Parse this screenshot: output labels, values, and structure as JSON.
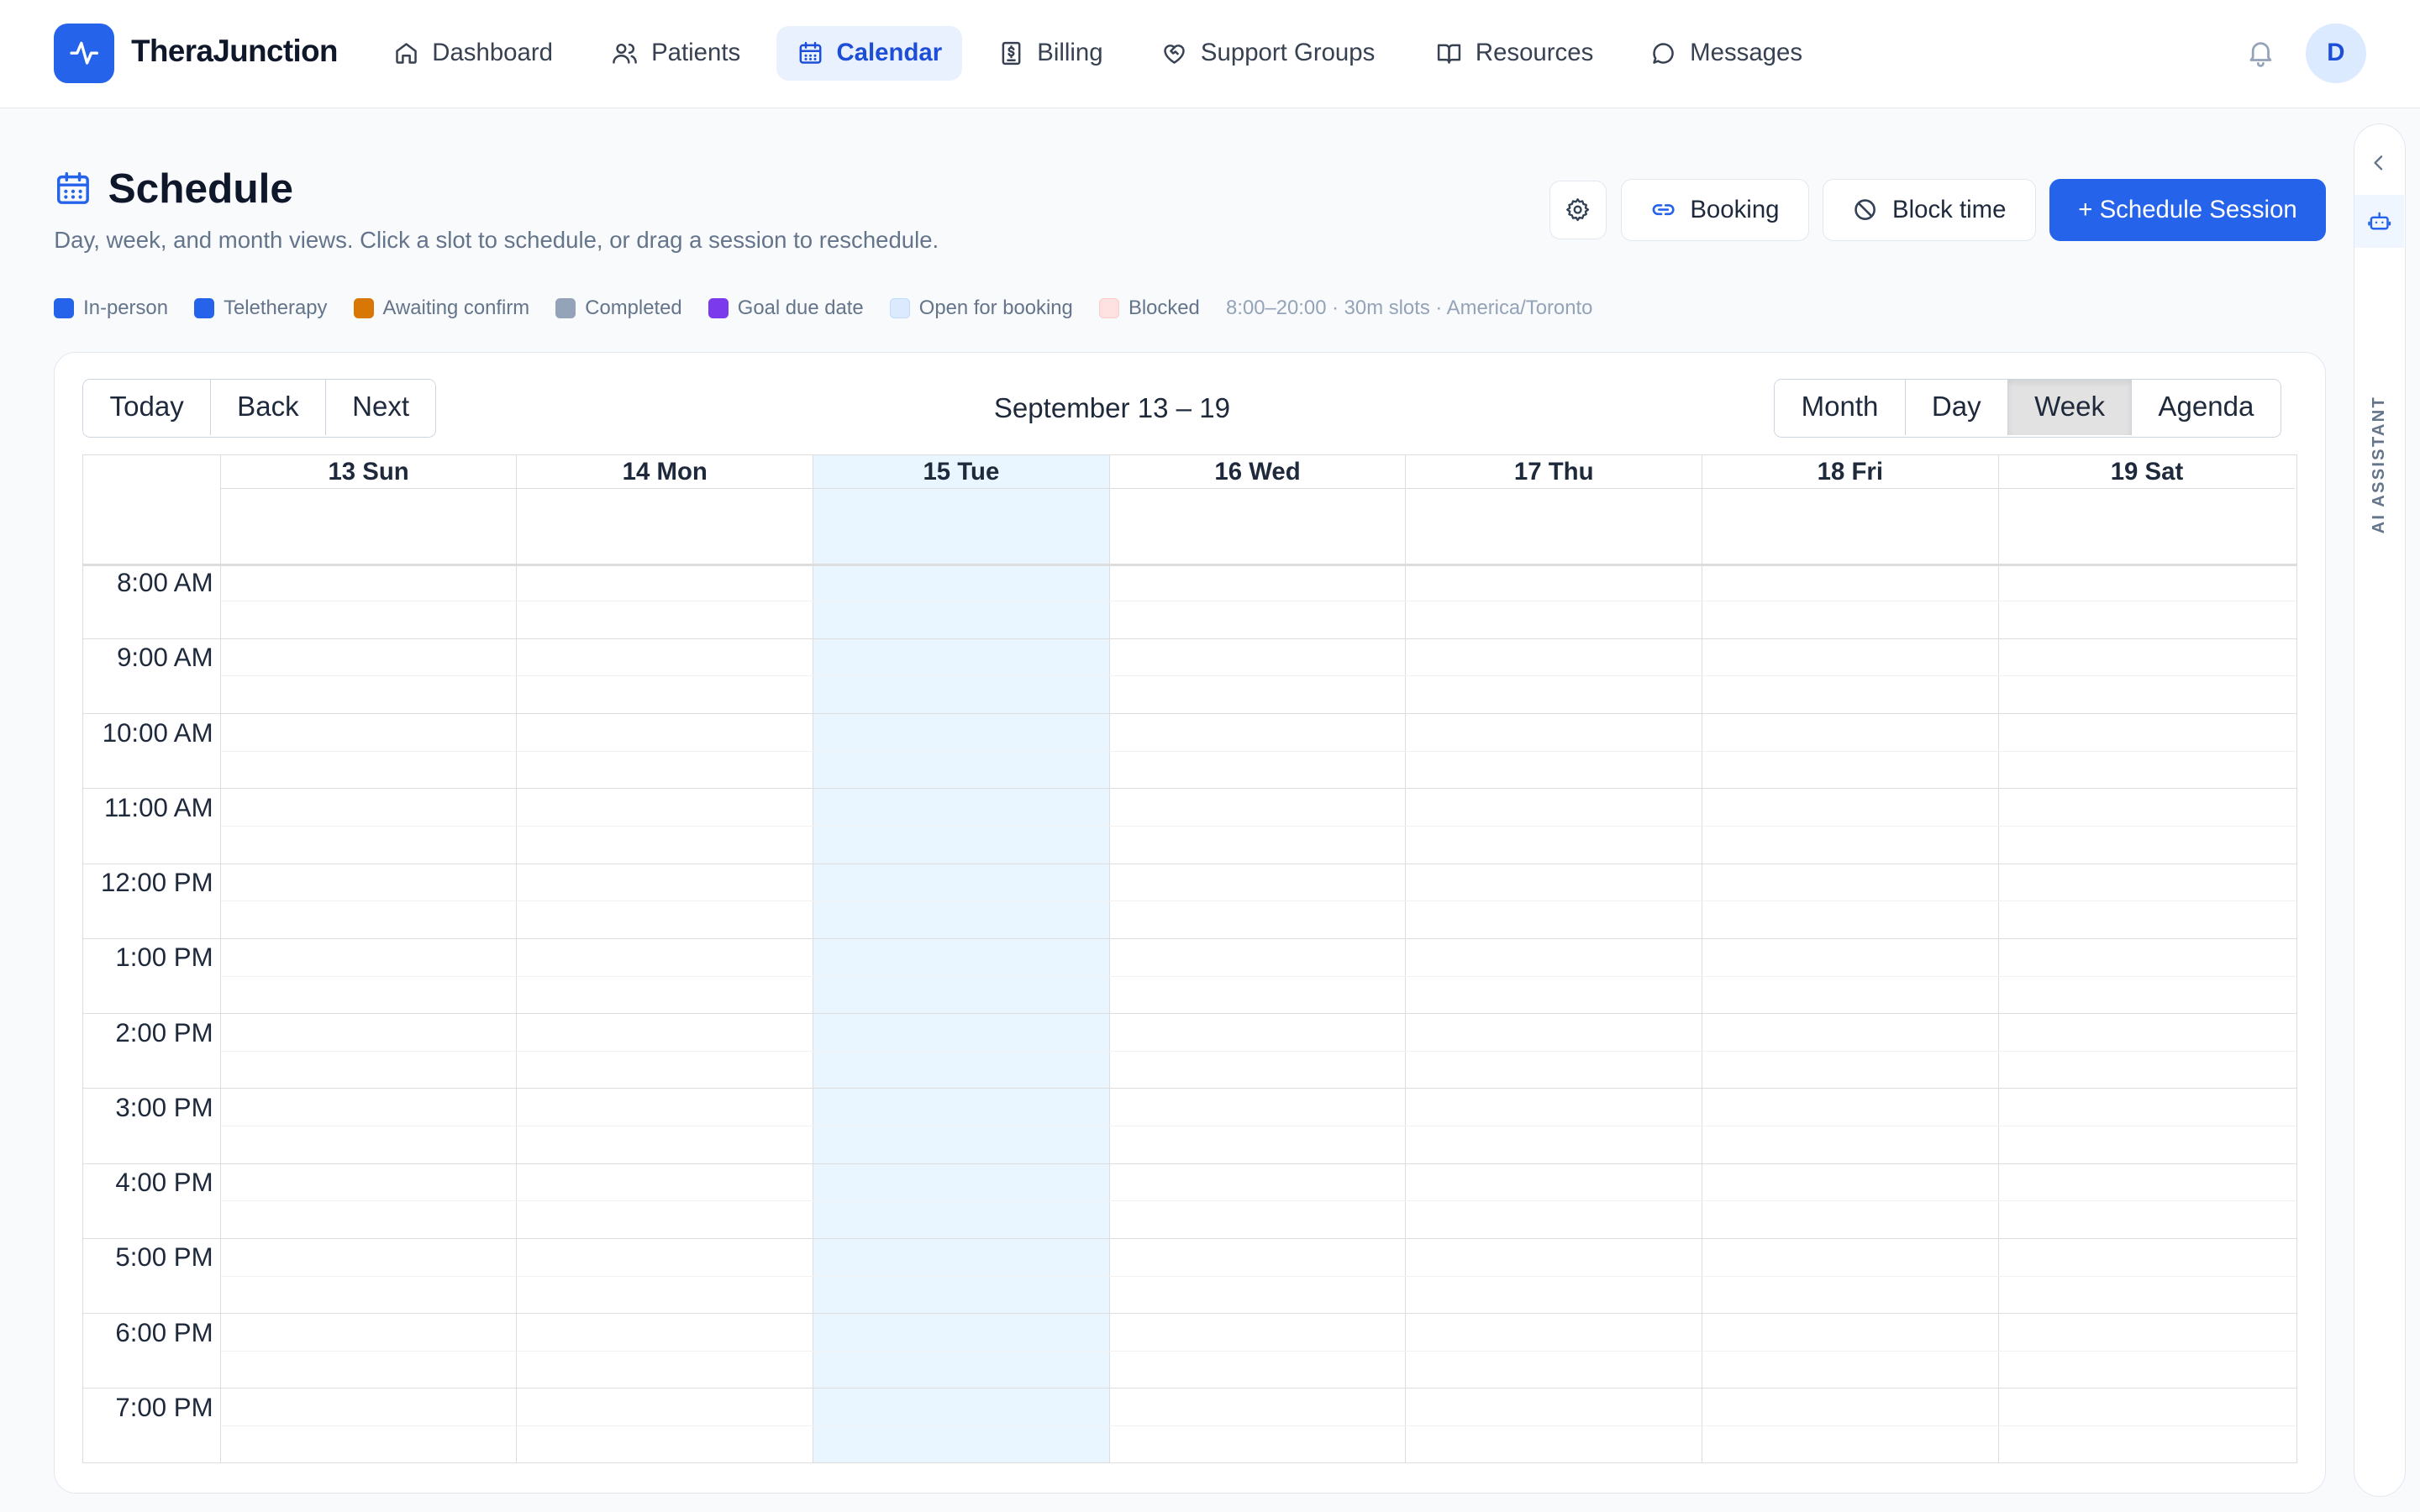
{
  "app": {
    "name": "TheraJunction",
    "user_initial": "D"
  },
  "nav": [
    {
      "label": "Dashboard",
      "icon": "home-icon"
    },
    {
      "label": "Patients",
      "icon": "users-icon"
    },
    {
      "label": "Calendar",
      "icon": "calendar-icon",
      "active": true
    },
    {
      "label": "Billing",
      "icon": "receipt-icon"
    },
    {
      "label": "Support Groups",
      "icon": "heart-handshake-icon"
    },
    {
      "label": "Resources",
      "icon": "book-icon"
    },
    {
      "label": "Messages",
      "icon": "message-icon"
    }
  ],
  "page": {
    "title": "Schedule",
    "subtitle": "Day, week, and month views. Click a slot to schedule, or drag a session to reschedule."
  },
  "actions": {
    "settings_icon": "gear-icon",
    "booking": "Booking",
    "block_time": "Block time",
    "schedule_session": "+ Schedule Session"
  },
  "legend": [
    {
      "label": "In-person",
      "color": "#2563eb"
    },
    {
      "label": "Teletherapy",
      "color": "#2563eb"
    },
    {
      "label": "Awaiting confirm",
      "color": "#d97706"
    },
    {
      "label": "Completed",
      "color": "#94a3b8"
    },
    {
      "label": "Goal due date",
      "color": "#7c3aed"
    },
    {
      "label": "Open for booking",
      "color": "#dbeafe"
    },
    {
      "label": "Blocked",
      "color": "#fee2e2"
    }
  ],
  "legend_meta": "8:00–20:00 · 30m slots · America/Toronto",
  "toolbar": {
    "today": "Today",
    "back": "Back",
    "next": "Next",
    "range": "September 13 – 19",
    "views": [
      "Month",
      "Day",
      "Week",
      "Agenda"
    ],
    "active_view": "Week"
  },
  "calendar": {
    "days": [
      "13 Sun",
      "14 Mon",
      "15 Tue",
      "16 Wed",
      "17 Thu",
      "18 Fri",
      "19 Sat"
    ],
    "today_index": 2,
    "hours": [
      "8:00 AM",
      "9:00 AM",
      "10:00 AM",
      "11:00 AM",
      "12:00 PM",
      "1:00 PM",
      "2:00 PM",
      "3:00 PM",
      "4:00 PM",
      "5:00 PM",
      "6:00 PM",
      "7:00 PM"
    ]
  },
  "side_panel": {
    "label": "AI ASSISTANT"
  }
}
